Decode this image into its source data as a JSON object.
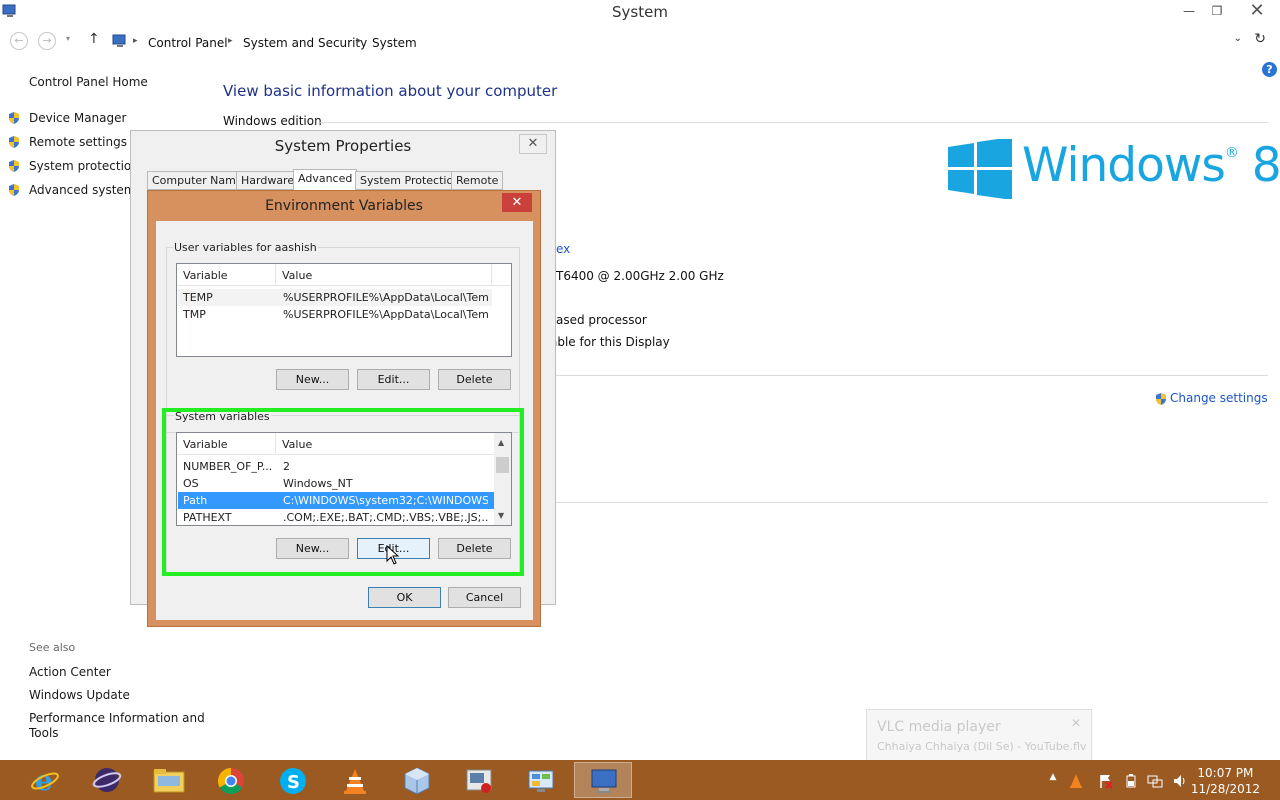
{
  "window": {
    "title": "System",
    "minimize": "—",
    "maximize": "❐",
    "close": "✕"
  },
  "address": {
    "crumbs": [
      "Control Panel",
      "System and Security",
      "System"
    ]
  },
  "left_pane": {
    "home": "Control Panel Home",
    "links": [
      "Device Manager",
      "Remote settings",
      "System protection",
      "Advanced system s"
    ],
    "see_also_heading": "See also",
    "see_also": [
      "Action Center",
      "Windows Update",
      "Performance Information and",
      "Tools"
    ]
  },
  "main": {
    "title": "View basic information about your computer",
    "section_edition": "Windows edition",
    "brand": "Windows",
    "brand_version": "8",
    "fragments": {
      "link_ex": "ex",
      "processor": "T6400  @ 2.00GHz   2.00 GHz",
      "system_type": "ased processor",
      "pen_touch": "able for this Display"
    },
    "change_settings": "Change settings",
    "help": "?"
  },
  "system_properties": {
    "title": "System Properties",
    "close": "✕",
    "tabs": [
      "Computer Name",
      "Hardware",
      "Advanced",
      "System Protection",
      "Remote"
    ],
    "active_tab": "Advanced"
  },
  "env_vars": {
    "title": "Environment Variables",
    "close": "✕",
    "user_group": "User variables for aashish",
    "user_columns": [
      "Variable",
      "Value"
    ],
    "user_rows": [
      {
        "variable": "TEMP",
        "value": "%USERPROFILE%\\AppData\\Local\\Temp"
      },
      {
        "variable": "TMP",
        "value": "%USERPROFILE%\\AppData\\Local\\Temp"
      }
    ],
    "user_buttons": {
      "new": "New...",
      "edit": "Edit...",
      "delete": "Delete"
    },
    "system_group": "System variables",
    "system_columns": [
      "Variable",
      "Value"
    ],
    "system_rows": [
      {
        "variable": "NUMBER_OF_P...",
        "value": "2"
      },
      {
        "variable": "OS",
        "value": "Windows_NT"
      },
      {
        "variable": "Path",
        "value": "C:\\WINDOWS\\system32;C:\\WINDOWS;..."
      },
      {
        "variable": "PATHEXT",
        "value": ".COM;.EXE;.BAT;.CMD;.VBS;.VBE;.JS;..."
      }
    ],
    "selected_row": "Path",
    "system_buttons": {
      "new": "New...",
      "edit": "Edit...",
      "delete": "Delete"
    },
    "ok": "OK",
    "cancel": "Cancel"
  },
  "toast": {
    "app": "VLC media player",
    "media": "Chhaiya Chhaiya (Dil Se) - YouTube.flv",
    "close": "✕"
  },
  "taskbar": {
    "items": [
      "internet-explorer",
      "eclipse",
      "file-explorer",
      "chrome",
      "skype",
      "vlc",
      "virtualbox",
      "media-app",
      "control-panel",
      "system-properties"
    ],
    "clock_time": "10:07 PM",
    "clock_date": "11/28/2012"
  },
  "colors": {
    "accent_link": "#1a55c8",
    "title_blue": "#1e3287",
    "windows_blue": "#19a6e0",
    "dialog_frame": "#d6915f",
    "taskbar": "#9a5a22",
    "highlight": "#22ee22",
    "selection": "#3399ff"
  }
}
